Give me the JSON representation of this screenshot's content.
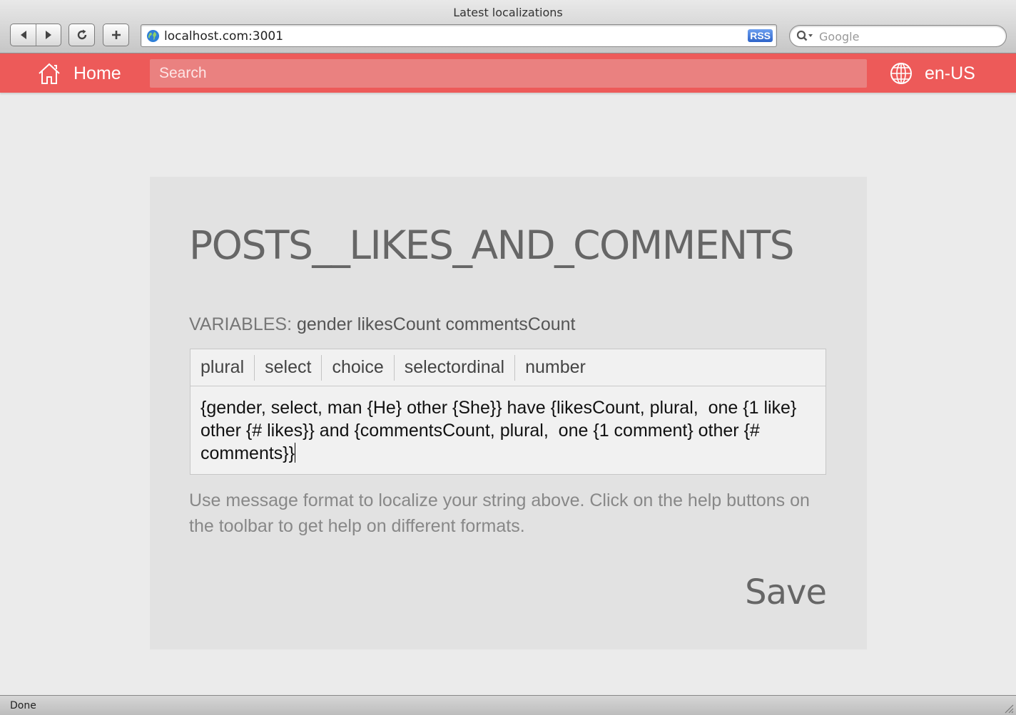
{
  "window": {
    "title": "Latest localizations",
    "url": "localhost.com:3001",
    "rss_label": "RSS",
    "search_placeholder": "Google",
    "status": "Done"
  },
  "appbar": {
    "home_label": "Home",
    "search_placeholder": "Search",
    "locale_label": "en-US",
    "accent_color": "#ed5a59"
  },
  "card": {
    "title": "POSTS__LIKES_AND_COMMENTS",
    "variables_label": "VARIABLES:",
    "variables_value": "gender likesCount commentsCount",
    "toolbar": [
      "plural",
      "select",
      "choice",
      "selectordinal",
      "number"
    ],
    "message": "{gender, select, man {He} other {She}} have {likesCount, plural,  one {1 like} other {# likes}} and {commentsCount, plural,  one {1 comment} other {# comments}}",
    "help_text": "Use message format to localize your string above. Click on the help buttons on the toolbar to get help on different formats.",
    "save_label": "Save"
  }
}
